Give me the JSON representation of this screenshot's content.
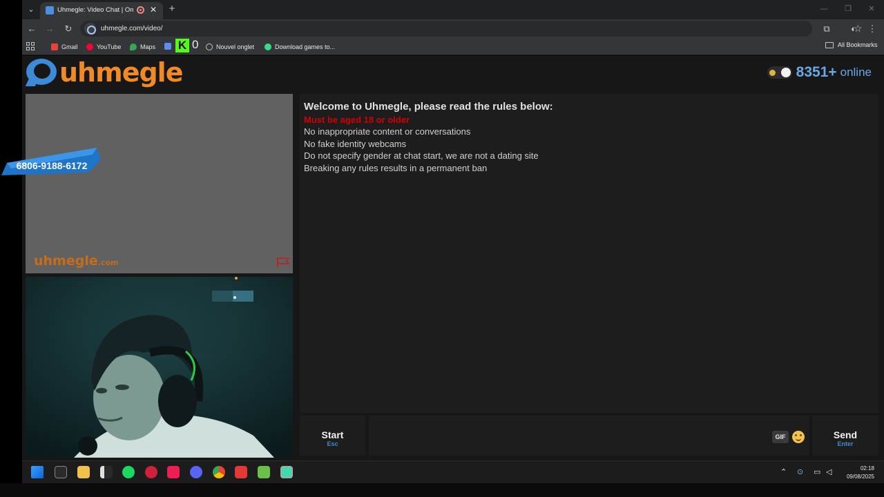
{
  "browser": {
    "tab_title": "Uhmegle: Video Chat | Ome",
    "url": "uhmegle.com/video/",
    "bookmarks": [
      "Gmail",
      "YouTube",
      "Maps",
      "Nouvel onglet",
      "Download games to..."
    ],
    "kick_count": "0",
    "all_bookmarks": "All Bookmarks"
  },
  "header": {
    "logo_text": "uhmegle",
    "online_count": "8351+",
    "online_label": "online"
  },
  "stranger": {
    "watermark": "uhmegle",
    "watermark_suffix": ".com"
  },
  "overlay": {
    "phone_number": "6806-9188-6172"
  },
  "rules": {
    "title": "Welcome to Uhmegle, please read the rules below:",
    "age": "Must be aged 18 or older",
    "items": [
      "No inappropriate content or conversations",
      "No fake identity webcams",
      "Do not specify gender at chat start, we are not a dating site",
      "Breaking any rules results in a permanent ban"
    ]
  },
  "controls": {
    "start_label": "Start",
    "start_key": "Esc",
    "gif_label": "GIF",
    "send_label": "Send",
    "send_key": "Enter"
  },
  "taskbar": {
    "time": "02:18",
    "date": "09/08/2025"
  },
  "colors": {
    "accent_blue": "#3d8ad8",
    "logo_orange": "#f08a24",
    "age_red": "#d40000",
    "online_blue": "#6aa8e6"
  }
}
